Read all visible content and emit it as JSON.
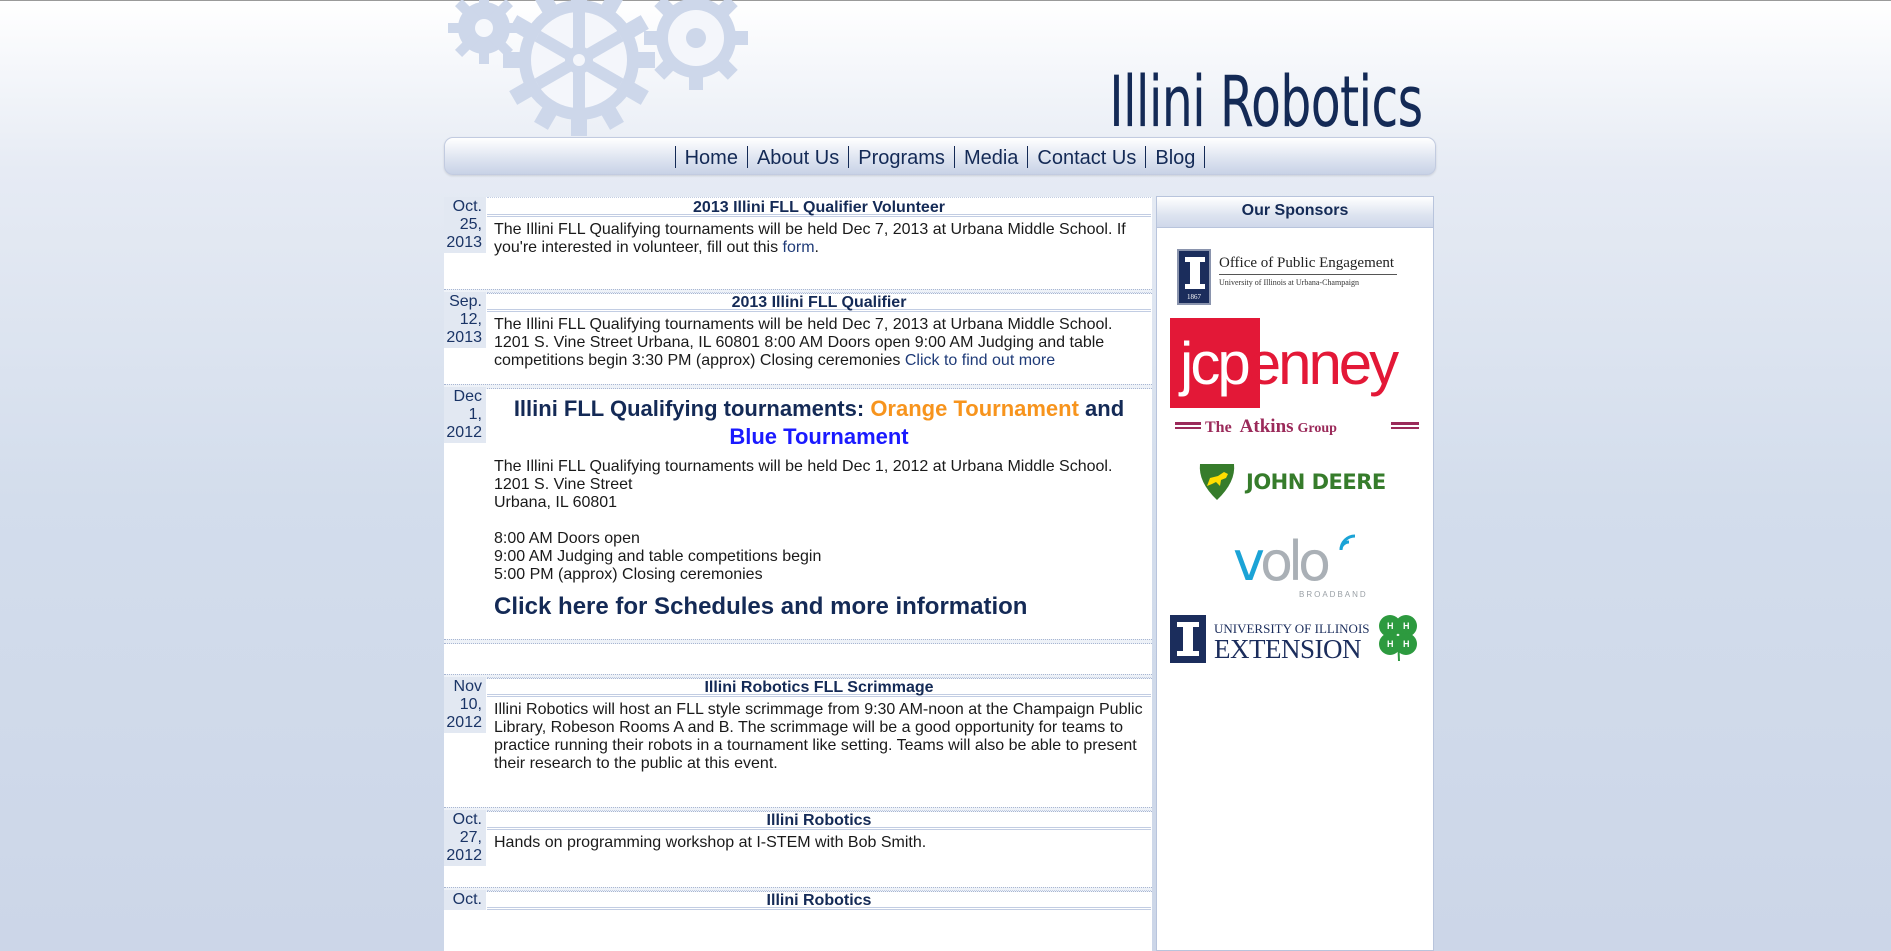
{
  "site": {
    "title": "Illini Robotics"
  },
  "nav": {
    "items": [
      "Home",
      "About Us",
      "Programs",
      "Media",
      "Contact Us",
      "Blog"
    ]
  },
  "posts": [
    {
      "date": [
        "Oct.",
        "25,",
        "2013"
      ],
      "title": "2013 Illini FLL Qualifier Volunteer",
      "body": "The Illini FLL Qualifying tournaments will be held Dec 7, 2013 at Urbana Middle School. If you're interested in volunteer, fill out this ",
      "link": "form",
      "after_link": "."
    },
    {
      "date": [
        "Sep.",
        "12,",
        "2013"
      ],
      "title": "2013 Illini FLL Qualifier",
      "body": "The Illini FLL Qualifying tournaments will be held Dec 7, 2013 at Urbana Middle School. 1201 S. Vine Street Urbana, IL 60801 8:00 AM Doors open 9:00 AM Judging and table competitions begin 3:30 PM (approx) Closing ceremonies ",
      "link": "Click to find out more"
    },
    {
      "date": [
        "Dec",
        "1,",
        "2012"
      ],
      "head_prefix": "Illini FLL Qualifying tournaments: ",
      "head_orange": "Orange Tournament",
      "head_and": " and ",
      "head_blue": "Blue Tournament",
      "lines": [
        "The Illini FLL Qualifying tournaments will be held Dec 1, 2012 at Urbana Middle School.",
        "1201 S. Vine Street",
        "Urbana, IL 60801",
        "",
        "8:00 AM Doors open",
        "9:00 AM Judging and table competitions begin",
        "5:00 PM (approx) Closing ceremonies"
      ],
      "cta": "Click here for Schedules and more information"
    },
    {
      "date": [
        "Nov",
        "10,",
        "2012"
      ],
      "title": "Illini Robotics FLL Scrimmage",
      "body": "Illini Robotics will host an FLL style scrimmage from 9:30 AM-noon at the Champaign Public Library, Robeson Rooms A and B. The scrimmage will be a good opportunity for teams to practice running their robots in a tournament like setting. Teams will also be able to present their research to the public at this event."
    },
    {
      "date": [
        "Oct.",
        "27,",
        "2012"
      ],
      "title": "Illini Robotics",
      "body": "Hands on programming workshop at I-STEM with Bob Smith."
    },
    {
      "date": [
        "Oct."
      ],
      "title": "Illini Robotics"
    }
  ],
  "sidebar": {
    "heading": "Our Sponsors",
    "logos": {
      "ope_title": "Office of Public Engagement",
      "ope_sub": "University of Illinois at Urbana-Champaign",
      "ope_year": "1867",
      "jcp": "jcpenney",
      "atkins_the": "The",
      "atkins_name": "Atkins",
      "atkins_group": "Group",
      "deere": "JOHN DEERE",
      "volo": "volo",
      "volo_sub": "BROADBAND",
      "ext_line1": "UNIVERSITY OF ILLINOIS",
      "ext_line2": "EXTENSION"
    }
  },
  "colors": {
    "navy": "#142a56",
    "orange": "#f7941d",
    "bright_blue": "#1a1aff",
    "jcp_red": "#e31837",
    "deere_green": "#367c2b",
    "deere_yellow": "#ffde00",
    "volo_blue": "#1ba3d6",
    "clover_green": "#2d9a3f"
  }
}
